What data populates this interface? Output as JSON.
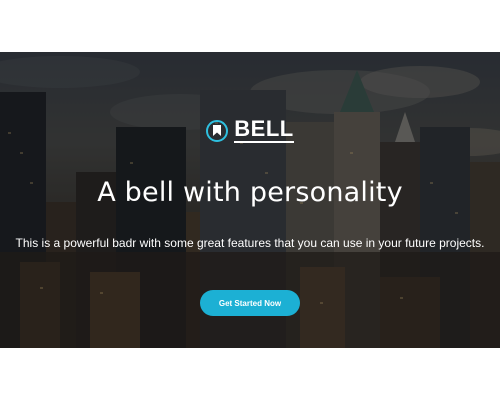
{
  "hero": {
    "brand": {
      "logo_icon": "bookmark-icon",
      "name": "BELL",
      "accent_color": "#2ec0e0"
    },
    "headline": "A bell with personality",
    "subheadline": "This is a powerful badr with some great features that you can use in your future projects.",
    "cta": {
      "label": "Get Started Now",
      "color": "#1cb0d4"
    }
  }
}
